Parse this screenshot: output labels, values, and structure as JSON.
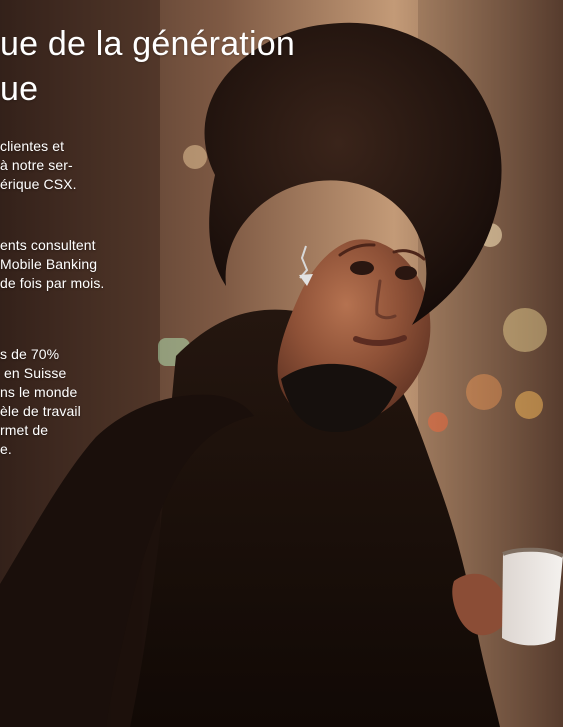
{
  "headline": {
    "line1": "ue de la génération",
    "line2": "ue"
  },
  "paragraphs": {
    "p1": "clientes et\nà notre ser-\nérique CSX.",
    "p2": "ents consultent\nMobile Banking\nde fois par mois.",
    "p3": "s de 70%\n en Suisse\nns le monde\nèle de travail\nrmet de\ne."
  }
}
